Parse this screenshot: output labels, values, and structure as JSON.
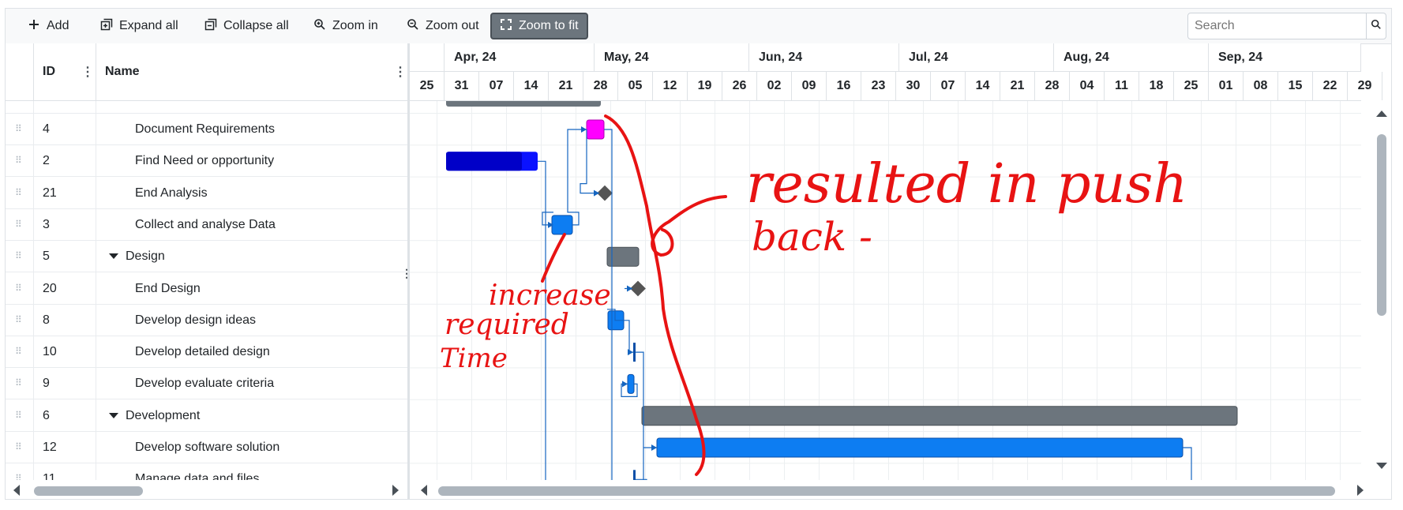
{
  "toolbar": {
    "add": "Add",
    "expand_all": "Expand all",
    "collapse_all": "Collapse all",
    "zoom_in": "Zoom in",
    "zoom_out": "Zoom out",
    "zoom_to_fit": "Zoom to fit",
    "search_placeholder": "Search"
  },
  "grid": {
    "columns": {
      "id": "ID",
      "name": "Name"
    },
    "rows": [
      {
        "id": "4",
        "name": "Document Requirements",
        "type": "task"
      },
      {
        "id": "2",
        "name": "Find Need or opportunity",
        "type": "task"
      },
      {
        "id": "21",
        "name": "End Analysis",
        "type": "task"
      },
      {
        "id": "3",
        "name": "Collect and analyse Data",
        "type": "task"
      },
      {
        "id": "5",
        "name": "Design",
        "type": "group"
      },
      {
        "id": "20",
        "name": "End Design",
        "type": "task"
      },
      {
        "id": "8",
        "name": "Develop design ideas",
        "type": "task"
      },
      {
        "id": "10",
        "name": "Develop detailed design",
        "type": "task"
      },
      {
        "id": "9",
        "name": "Develop evaluate criteria",
        "type": "task"
      },
      {
        "id": "6",
        "name": "Development",
        "type": "group"
      },
      {
        "id": "12",
        "name": "Develop software solution",
        "type": "task"
      },
      {
        "id": "11",
        "name": "Manage data and files",
        "type": "task"
      }
    ]
  },
  "timeline": {
    "months": [
      "Apr, 24",
      "May, 24",
      "Jun, 24",
      "Jul, 24",
      "Aug, 24",
      "Sep, 24"
    ],
    "weeks": [
      "25",
      "31",
      "07",
      "14",
      "21",
      "28",
      "05",
      "12",
      "19",
      "26",
      "02",
      "09",
      "16",
      "23",
      "30",
      "07",
      "14",
      "21",
      "28",
      "04",
      "11",
      "18",
      "25",
      "01",
      "08",
      "15",
      "22",
      "29"
    ]
  },
  "annotations": {
    "note_right_line1": "resulted in push",
    "note_right_line2": "back -",
    "note_left_line1": "increase",
    "note_left_line2": "required",
    "note_left_line3": "Time"
  },
  "colors": {
    "group_bar": "#6c757d",
    "task_bar": "#0d7df2",
    "highlight_task": "#ff00ff",
    "critical_task": "#0000c8",
    "milestone": "#555555",
    "annotation_ink": "#e81313"
  }
}
